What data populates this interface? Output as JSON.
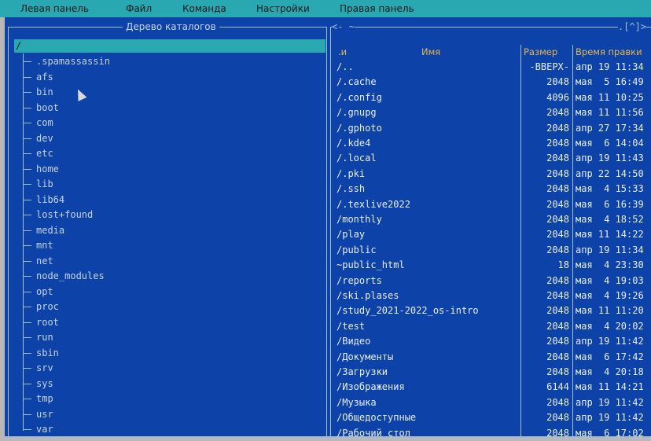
{
  "menubar": [
    "Левая панель",
    "Файл",
    "Команда",
    "Настройки",
    "Правая панель"
  ],
  "left_panel": {
    "title": "Дерево каталогов",
    "selected": "/",
    "items": [
      ".spamassassin",
      "afs",
      "bin",
      "boot",
      "com",
      "dev",
      "etc",
      "home",
      "lib",
      "lib64",
      "lost+found",
      "media",
      "mnt",
      "net",
      "node_modules",
      "opt",
      "proc",
      "root",
      "run",
      "sbin",
      "srv",
      "sys",
      "tmp",
      "usr",
      "var"
    ]
  },
  "right_panel": {
    "title_left": "<- ~ ",
    "title_right": ".[^]>",
    "headers": {
      "sort": ".и",
      "name": "Имя",
      "size": "Размер",
      "time": "Время правки"
    },
    "rows": [
      {
        "name": "/..",
        "size": "-ВВЕРХ-",
        "date": "апр 19 11:34"
      },
      {
        "name": "/.cache",
        "size": "2048",
        "date": "мая  5 16:49"
      },
      {
        "name": "/.config",
        "size": "4096",
        "date": "мая 11 10:25"
      },
      {
        "name": "/.gnupg",
        "size": "2048",
        "date": "мая 11 11:56"
      },
      {
        "name": "/.gphoto",
        "size": "2048",
        "date": "апр 27 17:34"
      },
      {
        "name": "/.kde4",
        "size": "2048",
        "date": "мая  6 14:04"
      },
      {
        "name": "/.local",
        "size": "2048",
        "date": "апр 19 11:43"
      },
      {
        "name": "/.pki",
        "size": "2048",
        "date": "апр 22 14:50"
      },
      {
        "name": "/.ssh",
        "size": "2048",
        "date": "мая  4 15:33"
      },
      {
        "name": "/.texlive2022",
        "size": "2048",
        "date": "мая  6 16:39"
      },
      {
        "name": "/monthly",
        "size": "2048",
        "date": "мая  4 18:52"
      },
      {
        "name": "/play",
        "size": "2048",
        "date": "мая 11 14:22"
      },
      {
        "name": "/public",
        "size": "2048",
        "date": "апр 19 11:34"
      },
      {
        "name": "~public_html",
        "size": "18",
        "date": "мая  4 23:30"
      },
      {
        "name": "/reports",
        "size": "2048",
        "date": "мая  4 19:03"
      },
      {
        "name": "/ski.plases",
        "size": "2048",
        "date": "мая  4 19:26"
      },
      {
        "name": "/study_2021-2022_os-intro",
        "size": "2048",
        "date": "мая 11 11:20"
      },
      {
        "name": "/test",
        "size": "2048",
        "date": "мая  4 20:02"
      },
      {
        "name": "/Видео",
        "size": "2048",
        "date": "апр 19 11:42"
      },
      {
        "name": "/Документы",
        "size": "2048",
        "date": "мая  6 17:42"
      },
      {
        "name": "/Загрузки",
        "size": "2048",
        "date": "мая  4 20:18"
      },
      {
        "name": "/Изображения",
        "size": "6144",
        "date": "мая 11 14:21"
      },
      {
        "name": "/Музыка",
        "size": "2048",
        "date": "апр 19 11:42"
      },
      {
        "name": "/Общедоступные",
        "size": "2048",
        "date": "апр 19 11:42"
      },
      {
        "name": "/Рабочий стол",
        "size": "2048",
        "date": "мая  6 17:02"
      }
    ]
  }
}
